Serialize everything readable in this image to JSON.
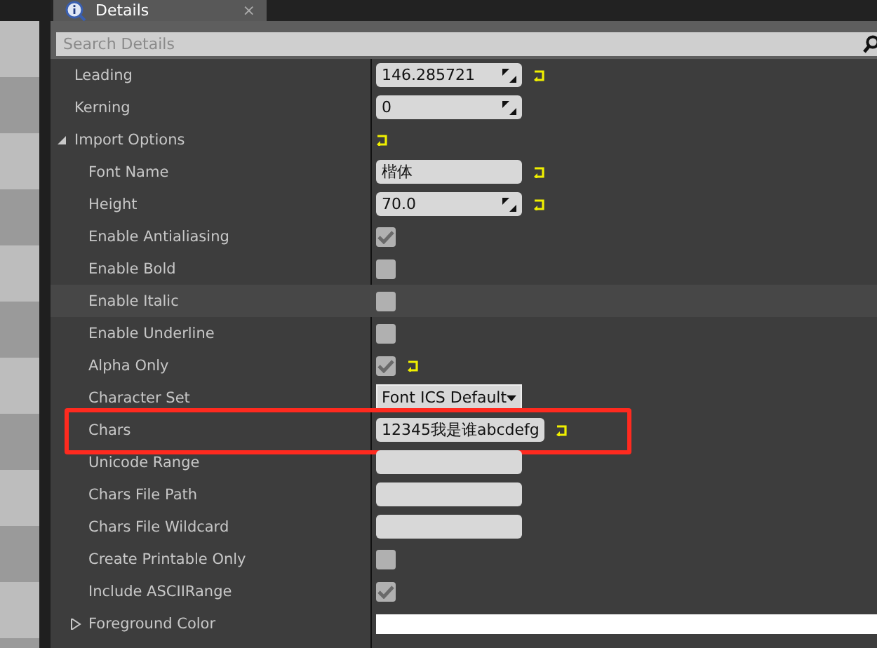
{
  "tab": {
    "label": "Details",
    "close": "×"
  },
  "search": {
    "placeholder": "Search Details"
  },
  "properties": [
    {
      "label": "Leading",
      "kind": "number",
      "value": "146.285721",
      "reset": true,
      "hovered": false,
      "highlighted": false
    },
    {
      "label": "Kerning",
      "kind": "number",
      "value": "0",
      "reset": false,
      "hovered": false,
      "highlighted": false
    },
    {
      "label": "Import Options",
      "kind": "category",
      "expanded": true,
      "reset": true,
      "hovered": false,
      "highlighted": false,
      "children": [
        {
          "label": "Font Name",
          "kind": "text",
          "value": "楷体",
          "reset": true,
          "hovered": false,
          "highlighted": false
        },
        {
          "label": "Height",
          "kind": "number",
          "value": "70.0",
          "reset": true,
          "hovered": false,
          "highlighted": false
        },
        {
          "label": "Enable Antialiasing",
          "kind": "checkbox",
          "checked": true,
          "reset": false,
          "hovered": false,
          "highlighted": false
        },
        {
          "label": "Enable Bold",
          "kind": "checkbox",
          "checked": false,
          "reset": false,
          "hovered": false,
          "highlighted": false
        },
        {
          "label": "Enable Italic",
          "kind": "checkbox",
          "checked": false,
          "reset": false,
          "hovered": true,
          "highlighted": false
        },
        {
          "label": "Enable Underline",
          "kind": "checkbox",
          "checked": false,
          "reset": false,
          "hovered": false,
          "highlighted": false
        },
        {
          "label": "Alpha Only",
          "kind": "checkbox",
          "checked": true,
          "reset": true,
          "hovered": false,
          "highlighted": false
        },
        {
          "label": "Character Set",
          "kind": "dropdown",
          "value": "Font ICS Default",
          "reset": false,
          "hovered": false,
          "highlighted": false
        },
        {
          "label": "Chars",
          "kind": "text",
          "value": "12345我是谁abcdefg",
          "reset": true,
          "hovered": false,
          "highlighted": true
        },
        {
          "label": "Unicode Range",
          "kind": "text",
          "reset": false,
          "hovered": false,
          "highlighted": false
        },
        {
          "label": "Chars File Path",
          "kind": "text",
          "reset": false,
          "hovered": false,
          "highlighted": false
        },
        {
          "label": "Chars File Wildcard",
          "kind": "text",
          "reset": false,
          "hovered": false,
          "highlighted": false
        },
        {
          "label": "Create Printable Only",
          "kind": "checkbox",
          "checked": false,
          "reset": false,
          "hovered": false,
          "highlighted": false
        },
        {
          "label": "Include ASCIIRange",
          "kind": "checkbox",
          "checked": true,
          "reset": false,
          "hovered": false,
          "highlighted": false
        },
        {
          "label": "Foreground Color",
          "kind": "color",
          "expanded": false,
          "reset": false,
          "hovered": false,
          "highlighted": false
        }
      ]
    }
  ]
}
